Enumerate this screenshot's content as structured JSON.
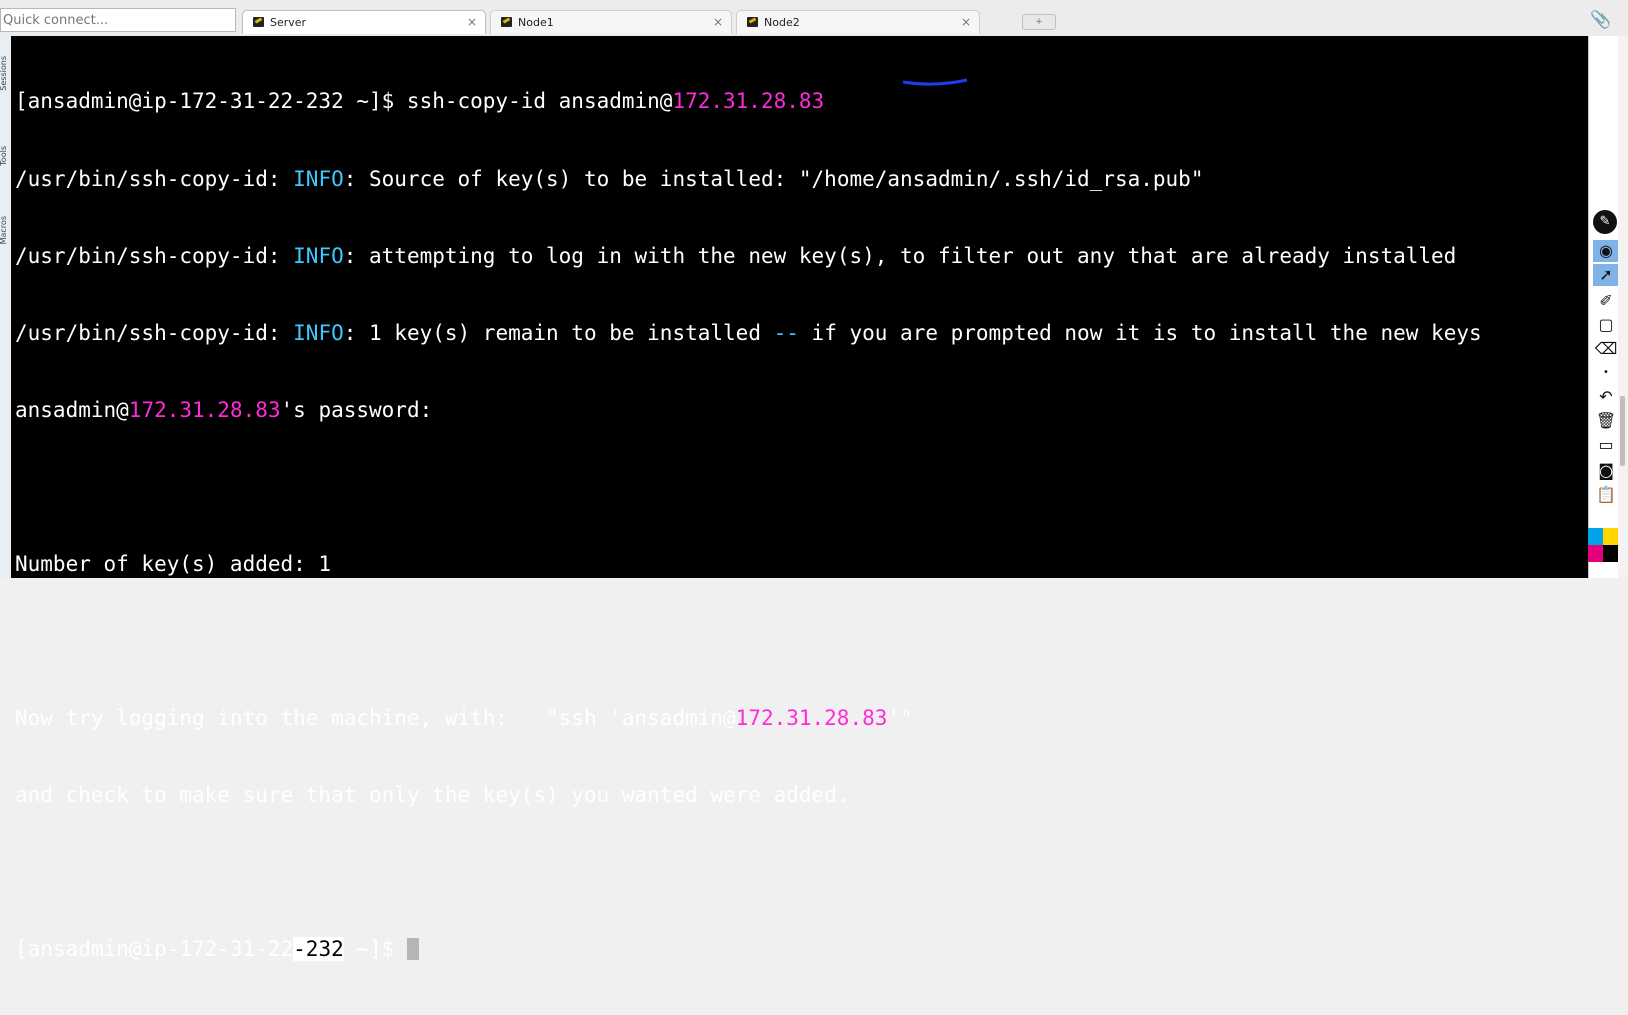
{
  "top": {
    "quick_connect_placeholder": "Quick connect...",
    "tabs": [
      {
        "label": "Server",
        "close": "×",
        "active": true
      },
      {
        "label": "Node1",
        "close": "×",
        "active": false
      },
      {
        "label": "Node2",
        "close": "×",
        "active": false
      }
    ],
    "new_tab_symbol": "+",
    "attach_icon": "paperclip-icon"
  },
  "terminal": {
    "line1": {
      "pre": "[ansadmin@ip-172-31-22-232 ~]$ ssh-copy-id ansadmin@",
      "ip": "172.31.28.83"
    },
    "line2": {
      "pre": "/usr/bin/ssh-copy-id: ",
      "info": "INFO",
      "post": ": Source of key(s) to be installed: \"/home/ansadmin/.ssh/id_rsa.pub\""
    },
    "line3": {
      "pre": "/usr/bin/ssh-copy-id: ",
      "info": "INFO",
      "post": ": attempting to log in with the new key(s), to filter out any that are already installed"
    },
    "line4": {
      "pre": "/usr/bin/ssh-copy-id: ",
      "info": "INFO",
      "mid": ": 1 key(s) remain to be installed ",
      "dashes": "--",
      "post": " if you are prompted now it is to install the new keys"
    },
    "line5": {
      "pre": "ansadmin@",
      "ip": "172.31.28.83",
      "post": "'s password:"
    },
    "line7": "Number of key(s) added: 1",
    "line9": {
      "pre": "Now try logging into the machine, with:   \"ssh 'ansadmin@",
      "ip": "172.31.28.83",
      "post": "'\""
    },
    "line10": "and check to make sure that only the key(s) you wanted were added.",
    "line12": {
      "pre": "[ansadmin@ip-172-31-22",
      "selected": "-232",
      "post": " ~]$ "
    }
  },
  "colors": {
    "terminal_bg": "#000000",
    "info": "#3fc7ff",
    "ip": "#ff2bd9",
    "text": "#ffffff"
  },
  "toolbar_icons": [
    "pen-icon",
    "eye-icon",
    "pointer-icon",
    "highlighter-icon",
    "rectangle-icon",
    "eraser-icon",
    "dot-icon",
    "undo-icon",
    "trash-icon",
    "screen-icon",
    "camera-icon",
    "clipboard-icon",
    "color-palette-icon"
  ],
  "left_strip_labels": [
    "Sessions",
    "Tools",
    "Macros"
  ]
}
